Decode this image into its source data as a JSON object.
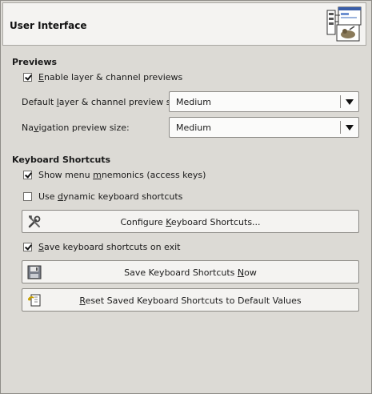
{
  "header": {
    "title": "User Interface",
    "icon": "preferences-icon"
  },
  "previews": {
    "title": "Previews",
    "enable_previews": {
      "prefix": "",
      "mnemonic": "E",
      "suffix": "nable layer & channel previews",
      "checked": true
    },
    "preview_size": {
      "label_prefix": "Default ",
      "label_mnemonic": "l",
      "label_suffix": "ayer & channel preview size:",
      "value": "Medium"
    },
    "nav_size": {
      "label_prefix": "Na",
      "label_mnemonic": "v",
      "label_suffix": "igation preview size:",
      "value": "Medium"
    }
  },
  "shortcuts": {
    "title": "Keyboard Shortcuts",
    "show_mnemonics": {
      "prefix": "Show menu ",
      "mnemonic": "m",
      "suffix": "nemonics (access keys)",
      "checked": true
    },
    "dynamic": {
      "prefix": "Use ",
      "mnemonic": "d",
      "suffix": "ynamic keyboard shortcuts",
      "checked": false
    },
    "configure": {
      "prefix": "Configure ",
      "mnemonic": "K",
      "suffix": "eyboard Shortcuts...",
      "icon": "tools-icon"
    },
    "save_on_exit": {
      "prefix": "",
      "mnemonic": "S",
      "suffix": "ave keyboard shortcuts on exit",
      "checked": true
    },
    "save_now": {
      "prefix": "Save Keyboard Shortcuts ",
      "mnemonic": "N",
      "suffix": "ow",
      "icon": "floppy-disk-icon"
    },
    "reset": {
      "prefix": "",
      "mnemonic": "R",
      "suffix": "eset Saved Keyboard Shortcuts to Default Values",
      "icon": "revert-icon"
    }
  }
}
